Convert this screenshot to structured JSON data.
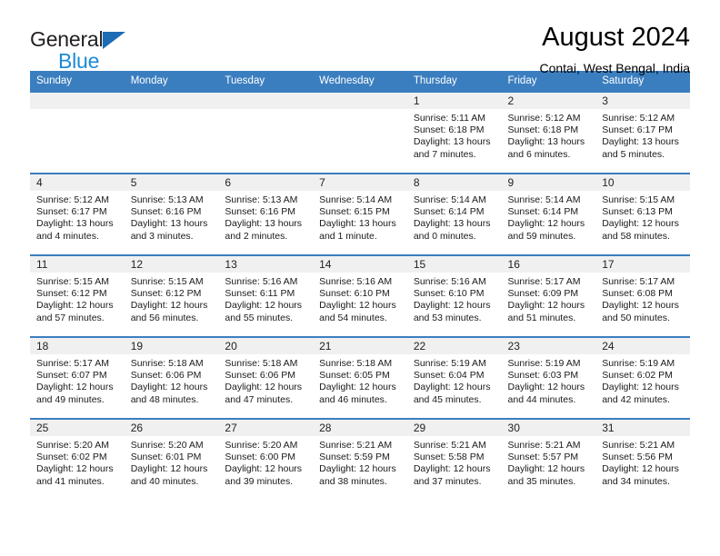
{
  "brand": {
    "word1": "General",
    "word2": "Blue",
    "triangle_color": "#1b6cb5",
    "blue_color": "#1b8ad6"
  },
  "header": {
    "title": "August 2024",
    "subtitle": "Contai, West Bengal, India"
  },
  "calendar": {
    "accent_color": "#3b7ebf",
    "daynum_bg": "#f0f0f0",
    "weekdays": [
      "Sunday",
      "Monday",
      "Tuesday",
      "Wednesday",
      "Thursday",
      "Friday",
      "Saturday"
    ],
    "weeks": [
      [
        {
          "empty": true
        },
        {
          "empty": true
        },
        {
          "empty": true
        },
        {
          "empty": true
        },
        {
          "day": "1",
          "sunrise": "Sunrise: 5:11 AM",
          "sunset": "Sunset: 6:18 PM",
          "daylight": "Daylight: 13 hours and 7 minutes."
        },
        {
          "day": "2",
          "sunrise": "Sunrise: 5:12 AM",
          "sunset": "Sunset: 6:18 PM",
          "daylight": "Daylight: 13 hours and 6 minutes."
        },
        {
          "day": "3",
          "sunrise": "Sunrise: 5:12 AM",
          "sunset": "Sunset: 6:17 PM",
          "daylight": "Daylight: 13 hours and 5 minutes."
        }
      ],
      [
        {
          "day": "4",
          "sunrise": "Sunrise: 5:12 AM",
          "sunset": "Sunset: 6:17 PM",
          "daylight": "Daylight: 13 hours and 4 minutes."
        },
        {
          "day": "5",
          "sunrise": "Sunrise: 5:13 AM",
          "sunset": "Sunset: 6:16 PM",
          "daylight": "Daylight: 13 hours and 3 minutes."
        },
        {
          "day": "6",
          "sunrise": "Sunrise: 5:13 AM",
          "sunset": "Sunset: 6:16 PM",
          "daylight": "Daylight: 13 hours and 2 minutes."
        },
        {
          "day": "7",
          "sunrise": "Sunrise: 5:14 AM",
          "sunset": "Sunset: 6:15 PM",
          "daylight": "Daylight: 13 hours and 1 minute."
        },
        {
          "day": "8",
          "sunrise": "Sunrise: 5:14 AM",
          "sunset": "Sunset: 6:14 PM",
          "daylight": "Daylight: 13 hours and 0 minutes."
        },
        {
          "day": "9",
          "sunrise": "Sunrise: 5:14 AM",
          "sunset": "Sunset: 6:14 PM",
          "daylight": "Daylight: 12 hours and 59 minutes."
        },
        {
          "day": "10",
          "sunrise": "Sunrise: 5:15 AM",
          "sunset": "Sunset: 6:13 PM",
          "daylight": "Daylight: 12 hours and 58 minutes."
        }
      ],
      [
        {
          "day": "11",
          "sunrise": "Sunrise: 5:15 AM",
          "sunset": "Sunset: 6:12 PM",
          "daylight": "Daylight: 12 hours and 57 minutes."
        },
        {
          "day": "12",
          "sunrise": "Sunrise: 5:15 AM",
          "sunset": "Sunset: 6:12 PM",
          "daylight": "Daylight: 12 hours and 56 minutes."
        },
        {
          "day": "13",
          "sunrise": "Sunrise: 5:16 AM",
          "sunset": "Sunset: 6:11 PM",
          "daylight": "Daylight: 12 hours and 55 minutes."
        },
        {
          "day": "14",
          "sunrise": "Sunrise: 5:16 AM",
          "sunset": "Sunset: 6:10 PM",
          "daylight": "Daylight: 12 hours and 54 minutes."
        },
        {
          "day": "15",
          "sunrise": "Sunrise: 5:16 AM",
          "sunset": "Sunset: 6:10 PM",
          "daylight": "Daylight: 12 hours and 53 minutes."
        },
        {
          "day": "16",
          "sunrise": "Sunrise: 5:17 AM",
          "sunset": "Sunset: 6:09 PM",
          "daylight": "Daylight: 12 hours and 51 minutes."
        },
        {
          "day": "17",
          "sunrise": "Sunrise: 5:17 AM",
          "sunset": "Sunset: 6:08 PM",
          "daylight": "Daylight: 12 hours and 50 minutes."
        }
      ],
      [
        {
          "day": "18",
          "sunrise": "Sunrise: 5:17 AM",
          "sunset": "Sunset: 6:07 PM",
          "daylight": "Daylight: 12 hours and 49 minutes."
        },
        {
          "day": "19",
          "sunrise": "Sunrise: 5:18 AM",
          "sunset": "Sunset: 6:06 PM",
          "daylight": "Daylight: 12 hours and 48 minutes."
        },
        {
          "day": "20",
          "sunrise": "Sunrise: 5:18 AM",
          "sunset": "Sunset: 6:06 PM",
          "daylight": "Daylight: 12 hours and 47 minutes."
        },
        {
          "day": "21",
          "sunrise": "Sunrise: 5:18 AM",
          "sunset": "Sunset: 6:05 PM",
          "daylight": "Daylight: 12 hours and 46 minutes."
        },
        {
          "day": "22",
          "sunrise": "Sunrise: 5:19 AM",
          "sunset": "Sunset: 6:04 PM",
          "daylight": "Daylight: 12 hours and 45 minutes."
        },
        {
          "day": "23",
          "sunrise": "Sunrise: 5:19 AM",
          "sunset": "Sunset: 6:03 PM",
          "daylight": "Daylight: 12 hours and 44 minutes."
        },
        {
          "day": "24",
          "sunrise": "Sunrise: 5:19 AM",
          "sunset": "Sunset: 6:02 PM",
          "daylight": "Daylight: 12 hours and 42 minutes."
        }
      ],
      [
        {
          "day": "25",
          "sunrise": "Sunrise: 5:20 AM",
          "sunset": "Sunset: 6:02 PM",
          "daylight": "Daylight: 12 hours and 41 minutes."
        },
        {
          "day": "26",
          "sunrise": "Sunrise: 5:20 AM",
          "sunset": "Sunset: 6:01 PM",
          "daylight": "Daylight: 12 hours and 40 minutes."
        },
        {
          "day": "27",
          "sunrise": "Sunrise: 5:20 AM",
          "sunset": "Sunset: 6:00 PM",
          "daylight": "Daylight: 12 hours and 39 minutes."
        },
        {
          "day": "28",
          "sunrise": "Sunrise: 5:21 AM",
          "sunset": "Sunset: 5:59 PM",
          "daylight": "Daylight: 12 hours and 38 minutes."
        },
        {
          "day": "29",
          "sunrise": "Sunrise: 5:21 AM",
          "sunset": "Sunset: 5:58 PM",
          "daylight": "Daylight: 12 hours and 37 minutes."
        },
        {
          "day": "30",
          "sunrise": "Sunrise: 5:21 AM",
          "sunset": "Sunset: 5:57 PM",
          "daylight": "Daylight: 12 hours and 35 minutes."
        },
        {
          "day": "31",
          "sunrise": "Sunrise: 5:21 AM",
          "sunset": "Sunset: 5:56 PM",
          "daylight": "Daylight: 12 hours and 34 minutes."
        }
      ]
    ]
  }
}
